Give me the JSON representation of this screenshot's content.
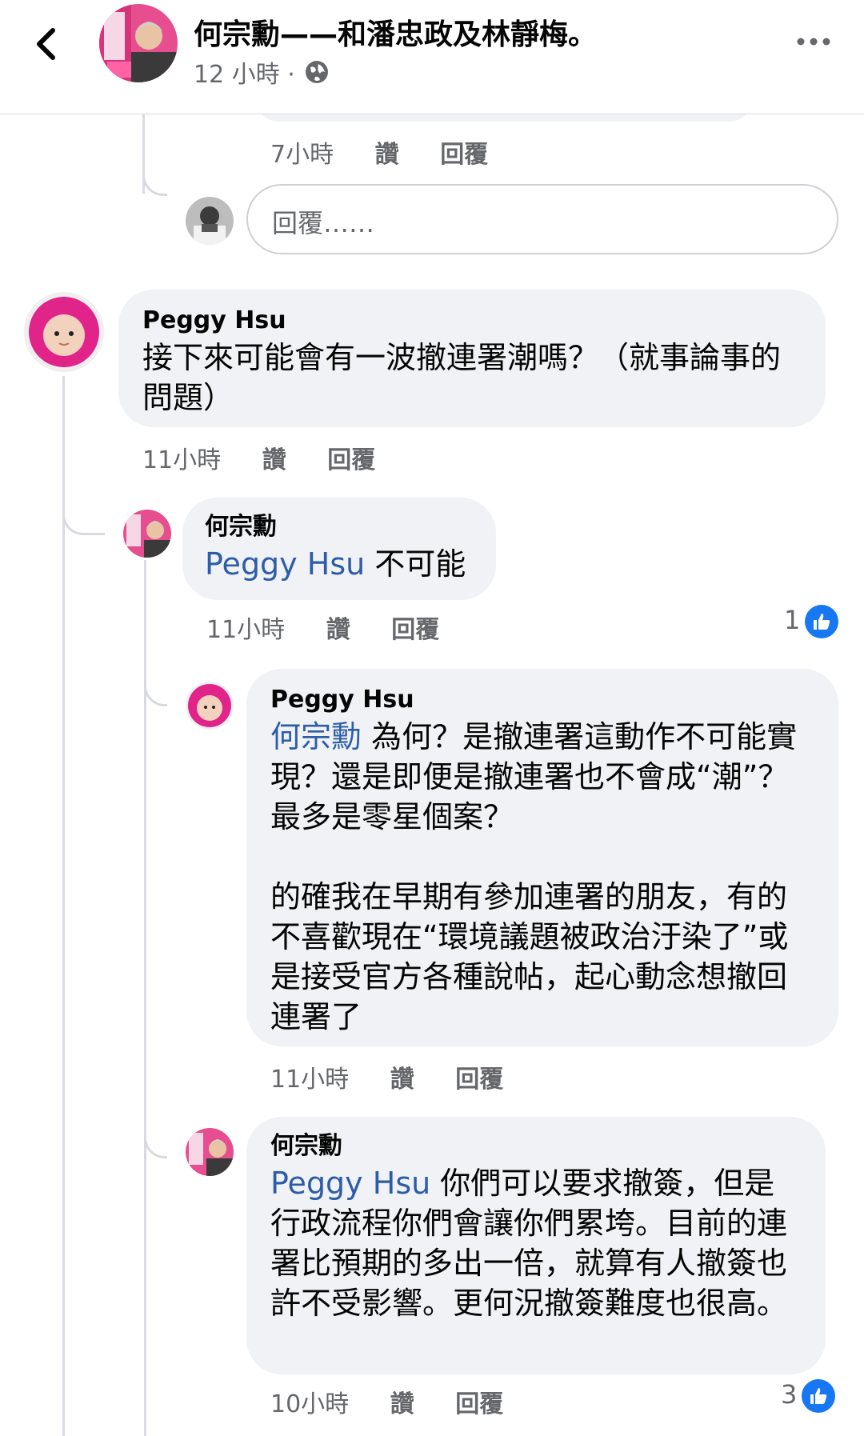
{
  "header": {
    "title": "何宗勳——和潘忠政及林靜梅。",
    "time": "12 小時 ·",
    "colors": {
      "text": "#050505",
      "muted": "#65676b",
      "link": "#2e5da8",
      "accent": "#1877f2"
    }
  },
  "top_actions": {
    "time": "7小時",
    "like": "讚",
    "reply": "回覆"
  },
  "reply_box": {
    "placeholder": "回覆……"
  },
  "comments": [
    {
      "author": "Peggy Hsu",
      "text": "接下來可能會有一波撤連署潮嗎？（就事論事的問題）",
      "time": "11小時",
      "like": "讚",
      "reply": "回覆"
    },
    {
      "author": "何宗勳",
      "mention": "Peggy Hsu",
      "text": " 不可能",
      "time": "11小時",
      "like": "讚",
      "reply": "回覆",
      "reactions": "1"
    },
    {
      "author": "Peggy Hsu",
      "mention": "何宗勳",
      "text_line1": " 為何？是撤連署這動作不可能",
      "text_rest": "實現？還是即便是撤連署也不會成“潮”？最多是零星個案？",
      "text_p2": "的確我在早期有參加連署的朋友，有的不喜歡現在“環境議題被政治汙染了”或是接受官方各種說帖，起心動念想撤回連署了",
      "time": "11小時",
      "like": "讚",
      "reply": "回覆"
    },
    {
      "author": "何宗勳",
      "mention": "Peggy Hsu",
      "text": " 你們可以要求撤簽，但是行政流程你們會讓你們累垮。目前的連署比預期的多出一倍，就算有人撤簽也許不受影響。更何況撤簽難度也很高。",
      "time": "10小時",
      "like": "讚",
      "reply": "回覆",
      "reactions": "3"
    }
  ]
}
